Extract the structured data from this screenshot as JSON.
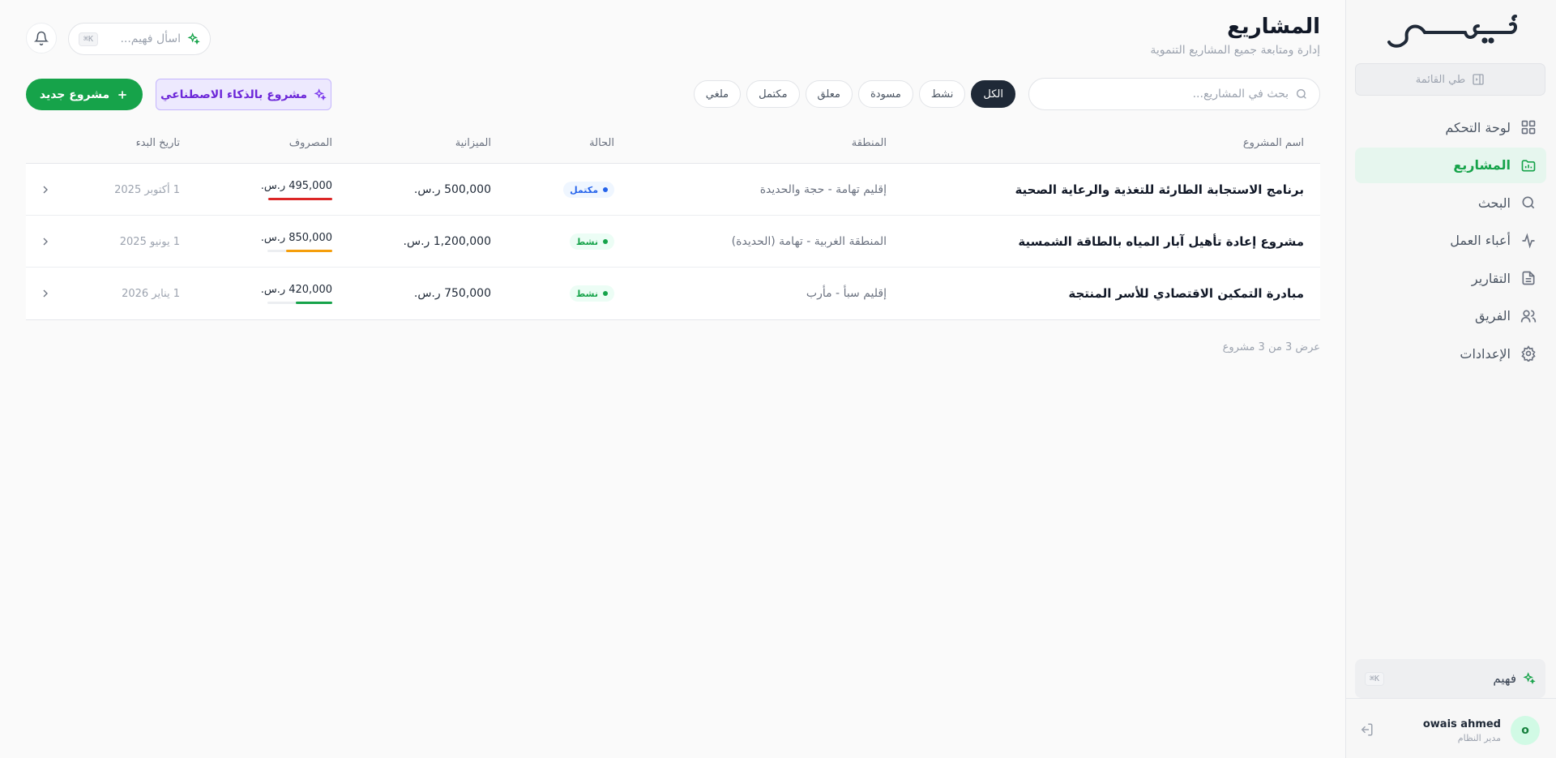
{
  "sidebar": {
    "logo_text": "فهيم",
    "collapse_label": "طي القائمة",
    "items": [
      {
        "label": "لوحة التحكم",
        "icon": "grid-icon"
      },
      {
        "label": "المشاريع",
        "icon": "folder-chart-icon"
      },
      {
        "label": "البحث",
        "icon": "search-icon"
      },
      {
        "label": "أعباء العمل",
        "icon": "activity-icon"
      },
      {
        "label": "التقارير",
        "icon": "file-text-icon"
      },
      {
        "label": "الفريق",
        "icon": "users-icon"
      },
      {
        "label": "الإعدادات",
        "icon": "gear-icon"
      }
    ],
    "active_index": 1,
    "ai_label": "فهيم",
    "ai_shortcut": "⌘K",
    "user": {
      "name": "owais ahmed",
      "role": "مدير النظام",
      "initial": "o"
    }
  },
  "header": {
    "title": "المشاريع",
    "subtitle": "إدارة ومتابعة جميع المشاريع التنموية",
    "ask_placeholder": "اسأل فهيم...",
    "ask_shortcut": "⌘K"
  },
  "toolbar": {
    "search_placeholder": "بحث في المشاريع...",
    "filters": [
      "الكل",
      "نشط",
      "مسودة",
      "معلق",
      "مكتمل",
      "ملغي"
    ],
    "active_filter": 0,
    "ai_project_label": "مشروع بالذكاء الاصطناعي",
    "new_project_label": "مشروع جديد"
  },
  "table": {
    "columns": {
      "name": "اسم المشروع",
      "region": "المنطقة",
      "status": "الحالة",
      "budget": "الميزانية",
      "spent": "المصروف",
      "start_date": "تاريخ البدء"
    },
    "rows": [
      {
        "name": "برنامج الاستجابة الطارئة للتغذية والرعاية الصحية",
        "region": "إقليم تهامة - حجة والحديدة",
        "status": "مكتمل",
        "status_kind": "done",
        "budget": "500,000 ر.س.",
        "spent": "495,000 ر.س.",
        "spent_ratio": 0.99,
        "bar_color": "#dc2626",
        "start_date": "1 أكتوبر 2025"
      },
      {
        "name": "مشروع إعادة تأهيل آبار المياه بالطاقة الشمسية",
        "region": "المنطقة الغربية - تهامة (الحديدة)",
        "status": "نشط",
        "status_kind": "active",
        "budget": "1,200,000 ر.س.",
        "spent": "850,000 ر.س.",
        "spent_ratio": 0.71,
        "bar_color": "#f59e0b",
        "start_date": "1 يونيو 2025"
      },
      {
        "name": "مبادرة التمكين الاقتصادي للأسر المنتجة",
        "region": "إقليم سبأ - مأرب",
        "status": "نشط",
        "status_kind": "active",
        "budget": "750,000 ر.س.",
        "spent": "420,000 ر.س.",
        "spent_ratio": 0.56,
        "bar_color": "#16a34a",
        "start_date": "1 يناير 2026"
      }
    ],
    "footer": "عرض 3 من 3 مشروع"
  },
  "colors": {
    "accent": "#16a34a",
    "ai_accent": "#7c3aed",
    "dark_chip": "#1f2937"
  }
}
